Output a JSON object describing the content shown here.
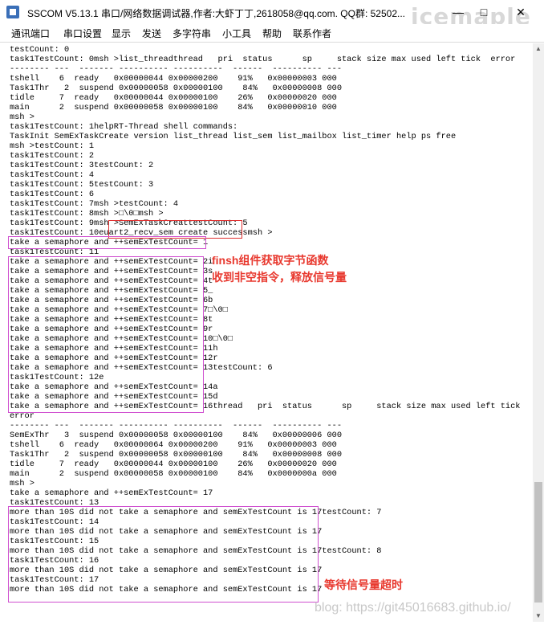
{
  "window": {
    "title": "SSCOM V5.13.1 串口/网络数据调试器,作者:大虾丁丁,2618058@qq.com. QQ群: 52502...",
    "minimize": "—",
    "maximize": "□",
    "close": "✕",
    "watermark": "icemaple"
  },
  "menu": [
    "通讯端口",
    "串口设置",
    "显示",
    "发送",
    "多字符串",
    "小工具",
    "帮助",
    "联系作者"
  ],
  "terminal": {
    "lines": [
      "testCount: 0",
      "task1TestCount: 0msh >list_threadthread   pri  status      sp     stack size max used left tick  error",
      "-------- ---  ------- ---------- ----------  ------  ---------- ---",
      "tshell    6  ready   0x00000044 0x00000200    91%   0x00000003 000",
      "Task1Thr   2  suspend 0x00000058 0x00000100    84%   0x00000008 000",
      "tidle     7  ready   0x00000044 0x00000100    26%   0x00000020 000",
      "main      2  suspend 0x00000058 0x00000100    84%   0x00000010 000",
      "msh >",
      "task1TestCount: 1helpRT-Thread shell commands:",
      "TaskInit SemExTaskCreate version list_thread list_sem list_mailbox list_timer help ps free",
      "msh >testCount: 1",
      "task1TestCount: 2",
      "task1TestCount: 3testCount: 2",
      "task1TestCount: 4",
      "task1TestCount: 5testCount: 3",
      "task1TestCount: 6",
      "task1TestCount: 7msh >testCount: 4",
      "task1TestCount: 8msh >□\\0□msh >",
      "task1TestCount: 9msh >SemExTaskCreattestCount: 5",
      "task1TestCount: 10euart2_recv_sem create successmsh >",
      "take a semaphore and ++semExTestCount= 1",
      "task1TestCount: 11",
      "take a semaphore and ++semExTestCount= 2i",
      "take a semaphore and ++semExTestCount= 3s",
      "take a semaphore and ++semExTestCount= 4t",
      "take a semaphore and ++semExTestCount= 5_",
      "take a semaphore and ++semExTestCount= 6b",
      "take a semaphore and ++semExTestCount= 7□\\0□",
      "take a semaphore and ++semExTestCount= 8t",
      "take a semaphore and ++semExTestCount= 9r",
      "take a semaphore and ++semExTestCount= 10□\\0□",
      "take a semaphore and ++semExTestCount= 11h",
      "take a semaphore and ++semExTestCount= 12r",
      "take a semaphore and ++semExTestCount= 13testCount: 6",
      "task1TestCount: 12e",
      "take a semaphore and ++semExTestCount= 14a",
      "take a semaphore and ++semExTestCount= 15d",
      "take a semaphore and ++semExTestCount= 16thread   pri  status      sp     stack size max used left tick",
      "error",
      "-------- ---  ------- ---------- ----------  ------  ---------- ---",
      "SemExThr   3  suspend 0x00000058 0x00000100    84%   0x00000006 000",
      "tshell    6  ready   0x00000064 0x00000200    91%   0x00000003 000",
      "Task1Thr   2  suspend 0x00000058 0x00000100    84%   0x00000008 000",
      "tidle     7  ready   0x00000044 0x00000100    26%   0x00000020 000",
      "main      2  suspend 0x00000058 0x00000100    84%   0x0000000a 000",
      "msh >",
      "take a semaphore and ++semExTestCount= 17",
      "task1TestCount: 13",
      "more than 10S did not take a semaphore and semExTestCount is 17testCount: 7",
      "task1TestCount: 14",
      "more than 10S did not take a semaphore and semExTestCount is 17",
      "task1TestCount: 15",
      "more than 10S did not take a semaphore and semExTestCount is 17testCount: 8",
      "task1TestCount: 16",
      "more than 10S did not take a semaphore and semExTestCount is 17",
      "task1TestCount: 17",
      "more than 10S did not take a semaphore and semExTestCount is 17"
    ]
  },
  "annotations": {
    "finsh_line1": "finsh组件获取字节函数",
    "finsh_line2": "收到非空指令，释放信号量",
    "timeout": "等待信号量超时"
  },
  "watermark_bottom": "blog: https://git45016683.github.io/",
  "colors": {
    "annotation": "#e8382e",
    "box_magenta": "#d050d0",
    "box_red": "#e03030"
  }
}
